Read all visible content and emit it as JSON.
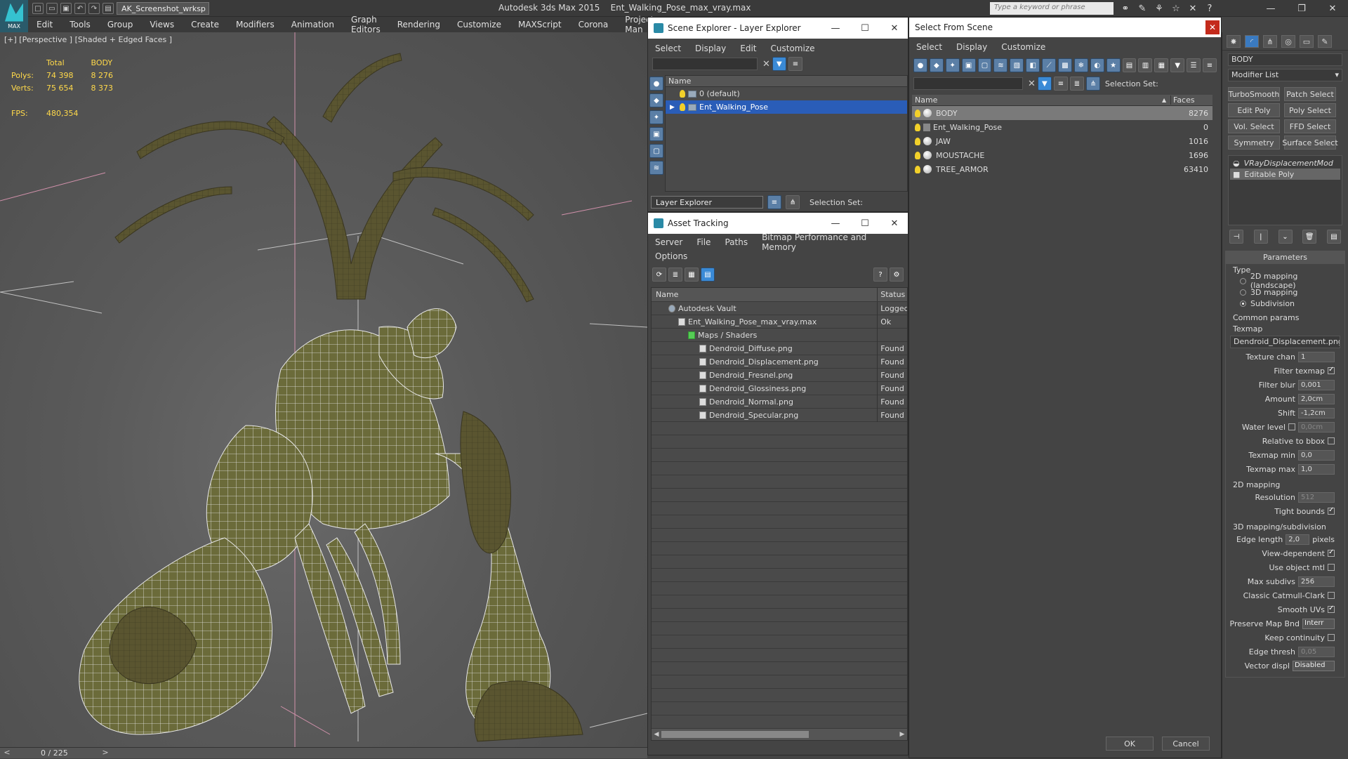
{
  "app": {
    "title": "Autodesk 3ds Max 2015",
    "file": "Ent_Walking_Pose_max_vray.max",
    "logo_text": "MAX",
    "workspace": "AK_Screenshot_wrksp",
    "search_placeholder": "Type a keyword or phrase"
  },
  "menu": [
    "Edit",
    "Tools",
    "Group",
    "Views",
    "Create",
    "Modifiers",
    "Animation",
    "Graph Editors",
    "Rendering",
    "Customize",
    "MAXScript",
    "Corona",
    "Project Man"
  ],
  "viewport": {
    "label": "[+] [Perspective ] [Shaded + Edged Faces ]",
    "stats": {
      "col_total": "Total",
      "col_body": "BODY",
      "polys_label": "Polys:",
      "polys_total": "74 398",
      "polys_body": "8 276",
      "verts_label": "Verts:",
      "verts_total": "75 654",
      "verts_body": "8 373",
      "fps_label": "FPS:",
      "fps_value": "480,354"
    },
    "timeline": "0 / 225"
  },
  "scene_explorer": {
    "title": "Scene Explorer - Layer Explorer",
    "menu": [
      "Select",
      "Display",
      "Edit",
      "Customize"
    ],
    "col_name": "Name",
    "rows": [
      {
        "name": "0 (default)",
        "selected": false
      },
      {
        "name": "Ent_Walking_Pose",
        "selected": true
      }
    ],
    "footer_dropdown": "Layer Explorer",
    "selection_set_label": "Selection Set:"
  },
  "asset_tracking": {
    "title": "Asset Tracking",
    "menu": [
      "Server",
      "File",
      "Paths",
      "Bitmap Performance and Memory"
    ],
    "menu2": [
      "Options"
    ],
    "col_name": "Name",
    "col_status": "Status",
    "rows": [
      {
        "name": "Autodesk Vault",
        "status": "Logged",
        "indent": 1
      },
      {
        "name": "Ent_Walking_Pose_max_vray.max",
        "status": "Ok",
        "indent": 2
      },
      {
        "name": "Maps / Shaders",
        "status": "",
        "indent": 3
      },
      {
        "name": "Dendroid_Diffuse.png",
        "status": "Found",
        "indent": 4
      },
      {
        "name": "Dendroid_Displacement.png",
        "status": "Found",
        "indent": 4
      },
      {
        "name": "Dendroid_Fresnel.png",
        "status": "Found",
        "indent": 4
      },
      {
        "name": "Dendroid_Glossiness.png",
        "status": "Found",
        "indent": 4
      },
      {
        "name": "Dendroid_Normal.png",
        "status": "Found",
        "indent": 4
      },
      {
        "name": "Dendroid_Specular.png",
        "status": "Found",
        "indent": 4
      }
    ]
  },
  "select_from_scene": {
    "title": "Select From Scene",
    "menu": [
      "Select",
      "Display",
      "Customize"
    ],
    "selection_set_label": "Selection Set:",
    "col_name": "Name",
    "col_faces": "Faces",
    "rows": [
      {
        "name": "BODY",
        "faces": "8276",
        "selected": true
      },
      {
        "name": "Ent_Walking_Pose",
        "faces": "0",
        "selected": false
      },
      {
        "name": "JAW",
        "faces": "1016",
        "selected": false
      },
      {
        "name": "MOUSTACHE",
        "faces": "1696",
        "selected": false
      },
      {
        "name": "TREE_ARMOR",
        "faces": "63410",
        "selected": false
      }
    ],
    "ok": "OK",
    "cancel": "Cancel"
  },
  "command_panel": {
    "object_name": "BODY",
    "modifier_list": "Modifier List",
    "modifiers": [
      "TurboSmooth",
      "Patch Select",
      "Edit Poly",
      "Poly Select",
      "Vol. Select",
      "FFD Select",
      "Symmetry",
      "Surface Select"
    ],
    "stack": [
      "VRayDisplacementMod",
      "Editable Poly"
    ],
    "parameters_title": "Parameters",
    "type_label": "Type",
    "type_options": [
      "2D mapping (landscape)",
      "3D mapping",
      "Subdivision"
    ],
    "common_params": "Common params",
    "texmap_label": "Texmap",
    "texmap_value": "Dendroid_Displacement.png)",
    "texture_chan_label": "Texture chan",
    "texture_chan": "1",
    "filter_texmap": "Filter texmap",
    "filter_blur_label": "Filter blur",
    "filter_blur": "0,001",
    "amount_label": "Amount",
    "amount": "2,0cm",
    "shift_label": "Shift",
    "shift": "-1,2cm",
    "water_level_label": "Water level",
    "water_level": "0,0cm",
    "relative_bbox": "Relative to bbox",
    "texmap_min_label": "Texmap min",
    "texmap_min": "0,0",
    "texmap_max_label": "Texmap max",
    "texmap_max": "1,0",
    "mapping2d": "2D mapping",
    "resolution_label": "Resolution",
    "resolution": "512",
    "tight_bounds": "Tight bounds",
    "mapping3d": "3D mapping/subdivision",
    "edge_length_label": "Edge length",
    "edge_length": "2,0",
    "pixels": "pixels",
    "view_dependent": "View-dependent",
    "use_object_mtl": "Use object mtl",
    "max_subdivs_label": "Max subdivs",
    "max_subdivs": "256",
    "classic_catmull": "Classic Catmull-Clark",
    "smooth_uvs": "Smooth UVs",
    "preserve_map_label": "Preserve Map Bnd",
    "preserve_map": "Interr",
    "keep_continuity": "Keep continuity",
    "edge_thresh_label": "Edge thresh",
    "edge_thresh": "0,05",
    "vector_displ_label": "Vector displ",
    "vector_displ": "Disabled"
  }
}
